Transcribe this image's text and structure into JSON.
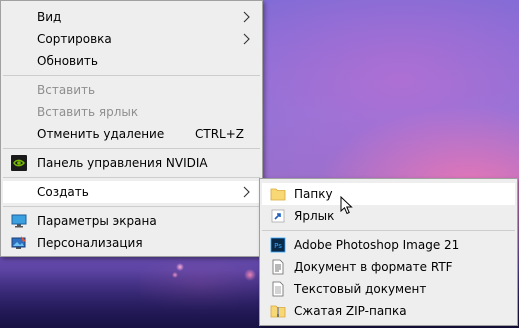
{
  "main_menu": {
    "view_label": "Вид",
    "sort_label": "Сортировка",
    "refresh_label": "Обновить",
    "paste_label": "Вставить",
    "paste_shortcut_label": "Вставить ярлык",
    "undo_delete_label": "Отменить удаление",
    "undo_delete_shortcut": "CTRL+Z",
    "nvidia_label": "Панель управления NVIDIA",
    "create_label": "Создать",
    "display_settings_label": "Параметры экрана",
    "personalize_label": "Персонализация"
  },
  "sub_menu": {
    "folder_label": "Папку",
    "shortcut_label": "Ярлык",
    "photoshop_label": "Adobe Photoshop Image 21",
    "rtf_label": "Документ в формате RTF",
    "text_doc_label": "Текстовый документ",
    "zip_label": "Сжатая ZIP-папка"
  },
  "icons": {
    "nvidia": "nvidia-icon",
    "display": "display-settings-icon",
    "personalize": "personalize-icon",
    "folder": "folder-icon",
    "shortcut": "shortcut-icon",
    "photoshop": "photoshop-icon",
    "rtf": "rtf-document-icon",
    "text": "text-document-icon",
    "zip": "zip-folder-icon"
  },
  "colors": {
    "menu_bg": "#eeeeee",
    "highlight_bg": "#ffffff",
    "disabled_text": "#8f8f8f",
    "nvidia_green": "#76b900",
    "folder_yellow": "#f8d775",
    "photoshop_blue": "#0a2a4a"
  }
}
